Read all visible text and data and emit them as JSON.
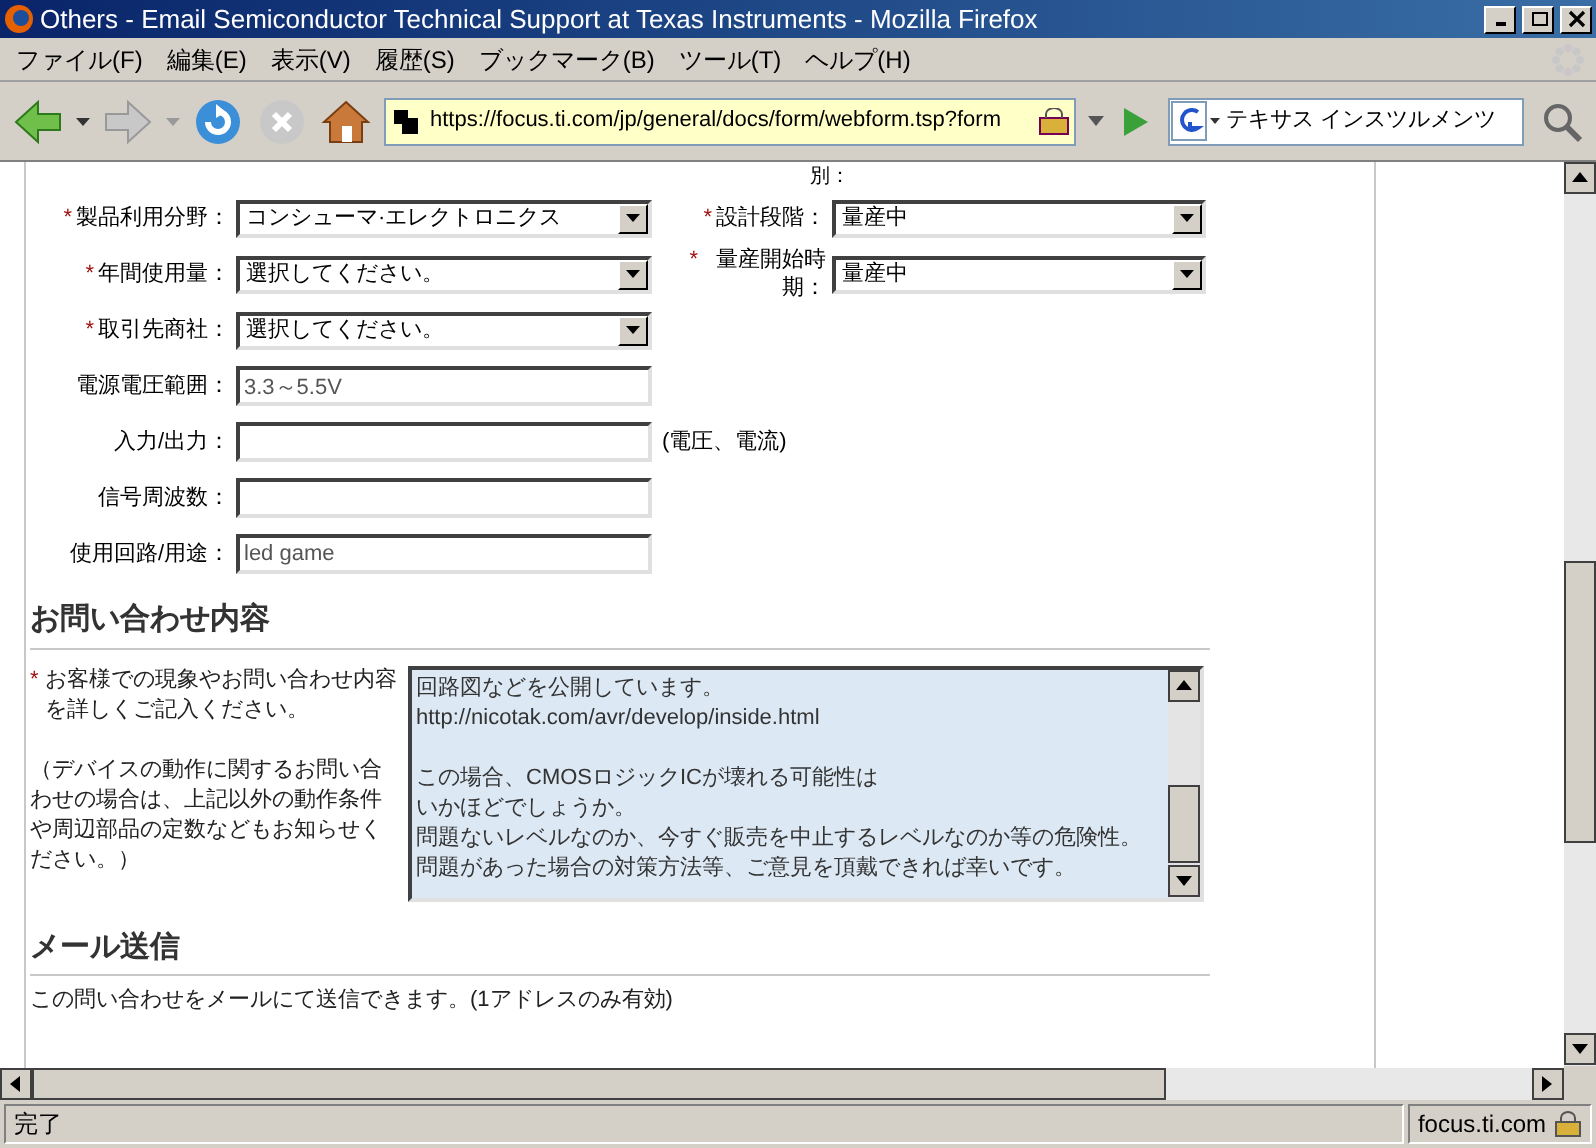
{
  "window": {
    "title": "Others - Email Semiconductor Technical Support at Texas Instruments - Mozilla Firefox"
  },
  "menu": [
    "ファイル(F)",
    "編集(E)",
    "表示(V)",
    "履歴(S)",
    "ブックマーク(B)",
    "ツール(T)",
    "ヘルプ(H)"
  ],
  "toolbar": {
    "url": "https://focus.ti.com/jp/general/docs/form/webform.tsp?form",
    "search": "テキサス インスツルメンツ"
  },
  "partial_label": "別：",
  "left_fields": [
    {
      "label": "製品利用分野：",
      "required": true,
      "kind": "select",
      "value": "コンシューマ·エレクトロニクス"
    },
    {
      "label": "年間使用量：",
      "required": true,
      "kind": "select",
      "value": "選択してください。"
    },
    {
      "label": "取引先商社：",
      "required": true,
      "kind": "select",
      "value": "選択してください。"
    },
    {
      "label": "電源電圧範囲：",
      "required": false,
      "kind": "input",
      "value": "3.3～5.5V"
    },
    {
      "label": "入力/出力：",
      "required": false,
      "kind": "input",
      "note": "(電圧、電流)"
    },
    {
      "label": "信号周波数：",
      "required": false,
      "kind": "input"
    },
    {
      "label": "使用回路/用途：",
      "required": false,
      "kind": "input",
      "value": "led game"
    }
  ],
  "right_fields": [
    {
      "label": "設計段階：",
      "required": true,
      "kind": "select",
      "value": "量産中"
    },
    {
      "label": "量産開始時期：",
      "required": true,
      "kind": "select",
      "value": "量産中"
    }
  ],
  "inquiry": {
    "heading": "お問い合わせ内容",
    "prompt": "お客様での現象やお問い合わせ内容を詳しくご記入ください。",
    "required": true,
    "note": "（デバイスの動作に関するお問い合わせの場合は、上記以外の動作条件や周辺部品の定数などもお知らせください。）",
    "message": [
      [
        "回路図などを公開しています。",
        "http://nicotak.com/avr/develop/inside.html"
      ],
      [
        "この場合、CMOSロジックICが壊れる可能性は",
        "いかほどでしょうか。",
        "問題ないレベルなのか、今すぐ販売を中止するレベルなのか等の危険性。",
        "問題があった場合の対策方法等、ご意見を頂戴できれば幸いです。"
      ]
    ]
  },
  "required_mark": "*",
  "mail": {
    "heading": "メール送信",
    "text": "この問い合わせをメールにて送信できます。(1アドレスのみ有効)"
  },
  "status_bar": {
    "text": "完了",
    "domain": "focus.ti.com"
  }
}
